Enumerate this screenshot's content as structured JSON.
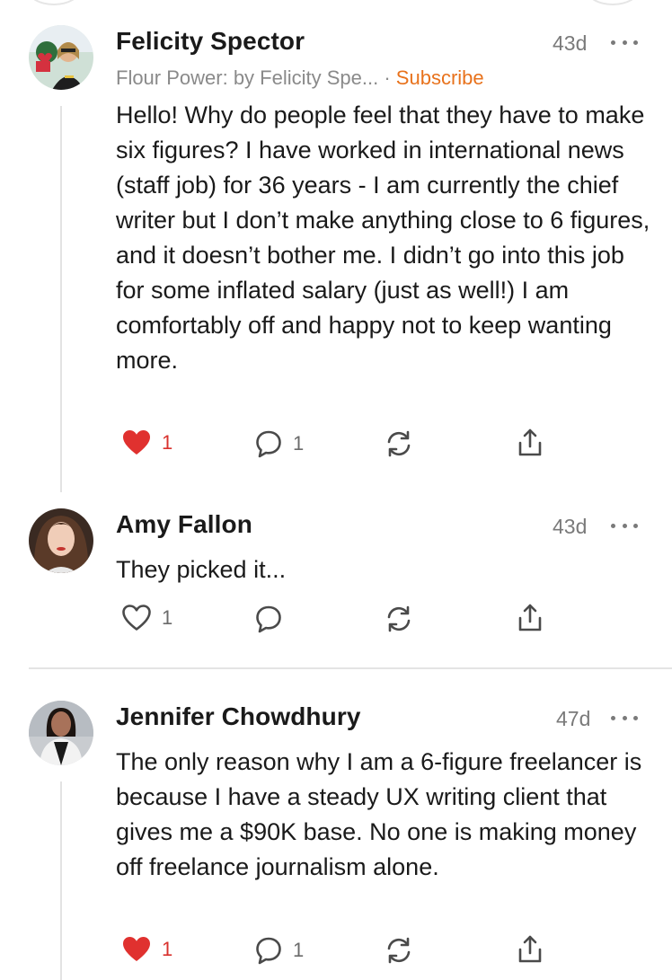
{
  "comments": [
    {
      "author": "Felicity Spector",
      "age": "43d",
      "publication": "Flour Power: by Felicity Spe...",
      "separator": "·",
      "subscribe": "Subscribe",
      "body": "Hello! Why do people feel that they have to make six figures? I have worked in international news (staff job) for 36 years - I am currently the chief writer but I don’t make anything close to 6 figures, and it doesn’t bother me. I didn’t go into this job for some inflated salary (just as well!) I am comfortably off and happy not to keep wanting more.",
      "likes": "1",
      "liked": true,
      "replies": "1"
    },
    {
      "author": "Amy Fallon",
      "age": "43d",
      "body": "They picked it...",
      "likes": "1",
      "liked": false,
      "replies": ""
    },
    {
      "author": "Jennifer Chowdhury",
      "age": "47d",
      "body": "The only reason why I am a 6-figure freelancer is because I have a steady UX writing client that gives me a $90K base. No one is making money off freelance journalism alone.",
      "likes": "1",
      "liked": true,
      "replies": "1"
    }
  ],
  "colors": {
    "like_active": "#e0312f",
    "subscribe": "#e8721c",
    "icon_gray": "#4a4a4a"
  }
}
